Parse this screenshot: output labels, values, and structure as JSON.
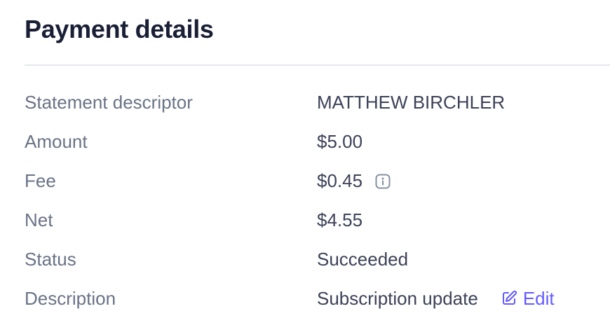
{
  "header": {
    "title": "Payment details"
  },
  "rows": [
    {
      "label": "Statement descriptor",
      "value": "MATTHEW BIRCHLER"
    },
    {
      "label": "Amount",
      "value": "$5.00"
    },
    {
      "label": "Fee",
      "value": "$0.45",
      "icon": "info-icon"
    },
    {
      "label": "Net",
      "value": "$4.55"
    },
    {
      "label": "Status",
      "value": "Succeeded"
    },
    {
      "label": "Description",
      "value": "Subscription update",
      "action": {
        "label": "Edit",
        "icon": "edit-icon"
      }
    }
  ],
  "colors": {
    "title": "#1a1f36",
    "label": "#697386",
    "value": "#3c4257",
    "accent": "#635bff",
    "divider": "#e6e8ec"
  }
}
